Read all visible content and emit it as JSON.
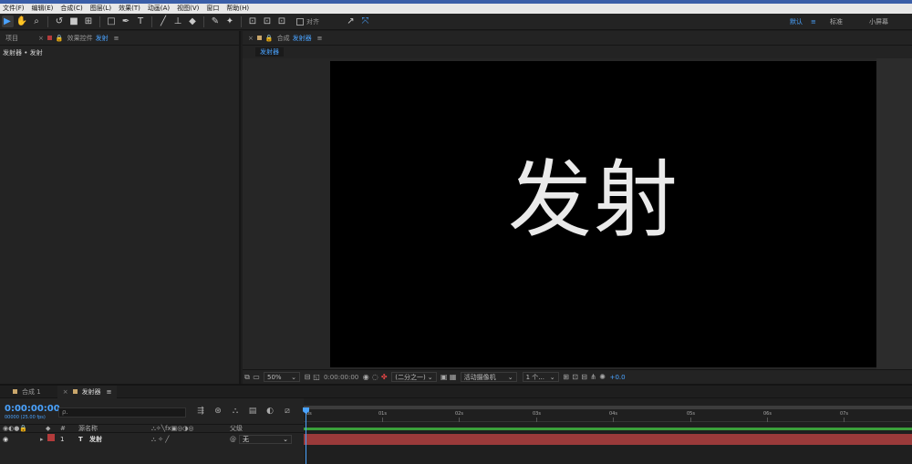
{
  "menu": [
    "文件(F)",
    "编辑(E)",
    "合成(C)",
    "图层(L)",
    "效果(T)",
    "动画(A)",
    "视图(V)",
    "窗口",
    "帮助(H)"
  ],
  "toolbar": {
    "tools": [
      "selection-tool",
      "hand-tool",
      "zoom-tool",
      "rotate-tool",
      "camera-tool",
      "pan-behind-tool",
      "rectangle-tool",
      "pen-tool",
      "type-tool",
      "brush-tool",
      "clone-stamp-tool",
      "eraser-tool",
      "roto-brush-tool",
      "puppet-pin-tool"
    ],
    "snap_label": "对齐",
    "workspace_default": "默认",
    "workspace_menu": "≡",
    "workspace_standard": "标准",
    "workspace_small": "小屏幕"
  },
  "left_panel": {
    "tab_project": "项目",
    "tab_effects": "效果控件",
    "tab_effects_target": "发射",
    "menu_icon": "≡",
    "breadcrumb": "发射器 • 发射"
  },
  "comp_panel": {
    "tab_prefix": "合成",
    "tab_name": "发射器",
    "menu_icon": "≡",
    "subtab": "发射器",
    "canvas_text": "发射"
  },
  "viewer_footer": {
    "zoom": "50%",
    "timecode": "0:00:00:00",
    "resolution": "(二分之一)",
    "camera": "活动摄像机",
    "views": "1 个...",
    "exposure": "+0.0"
  },
  "timeline": {
    "tab_comp": "合成 1",
    "tab_active": "发射器",
    "menu_icon": "≡",
    "timecode": "0:00:00:00",
    "fps": "00000 (25.00 fps)",
    "search_placeholder": "ρ.",
    "col_hash": "#",
    "col_source": "源名称",
    "col_parent": "父级",
    "ruler": [
      "0s",
      "01s",
      "02s",
      "03s",
      "04s",
      "05s",
      "06s",
      "07s"
    ],
    "layers": [
      {
        "index": "1",
        "type": "T",
        "name": "发射",
        "parent": "无"
      }
    ]
  },
  "colors": {
    "accent": "#4aa3ff",
    "label_red": "#b33b3b",
    "work_area": "#3aa03a",
    "layer_bar": "#9a3a3a"
  }
}
